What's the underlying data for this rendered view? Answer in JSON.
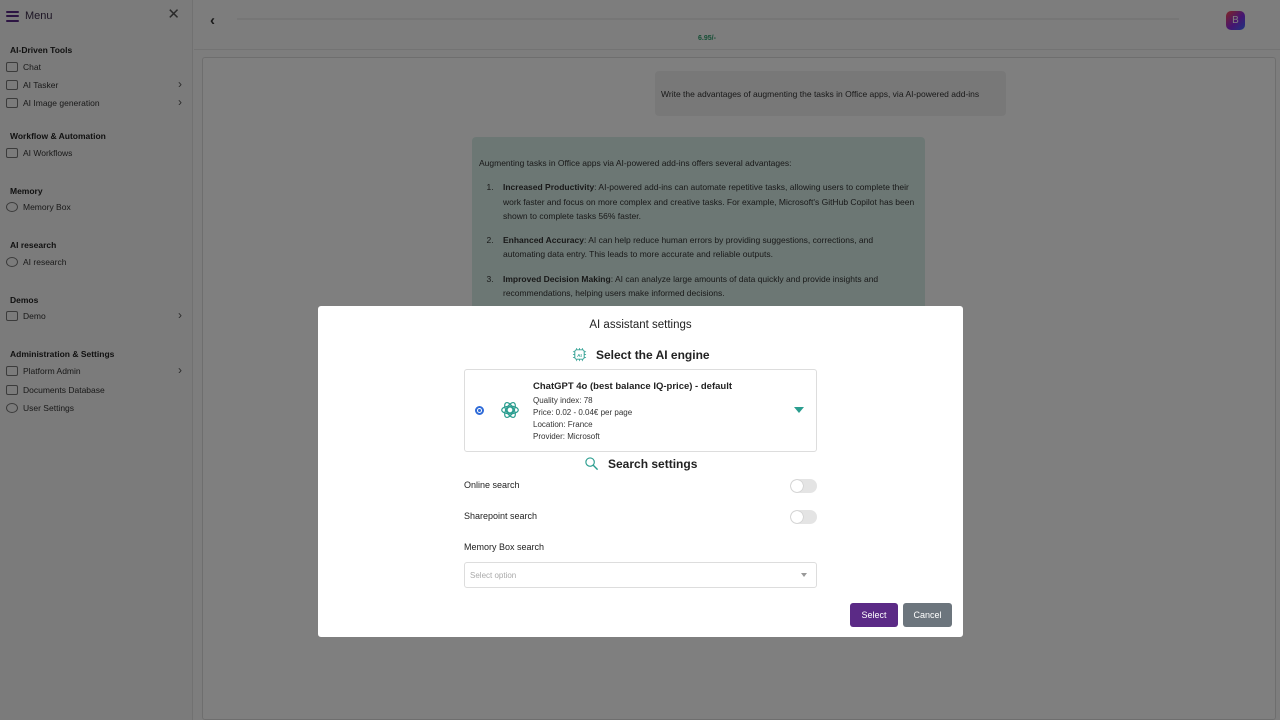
{
  "sidebar": {
    "menu_label": "Menu",
    "sections": [
      {
        "title": "AI-Driven Tools",
        "items": [
          {
            "label": "Chat",
            "icon": "chat-icon"
          },
          {
            "label": "AI Tasker",
            "icon": "tasker-icon"
          },
          {
            "label": "AI Image generation",
            "icon": "image-icon"
          }
        ]
      },
      {
        "title": "Workflow & Automation",
        "items": [
          {
            "label": "AI Workflows",
            "icon": "workflow-icon"
          }
        ]
      },
      {
        "title": "Memory",
        "items": [
          {
            "label": "Memory Box",
            "icon": "memory-icon"
          }
        ]
      },
      {
        "title": "AI research",
        "items": [
          {
            "label": "AI research",
            "icon": "research-icon"
          }
        ]
      },
      {
        "title": "Demos",
        "items": [
          {
            "label": "Demo",
            "icon": "demo-icon"
          }
        ]
      },
      {
        "title": "Administration & Settings",
        "items": [
          {
            "label": "Platform Admin",
            "icon": "admin-icon"
          },
          {
            "label": "Documents Database",
            "icon": "documents-icon"
          },
          {
            "label": "User Settings",
            "icon": "user-icon"
          }
        ]
      }
    ]
  },
  "topbar": {
    "price": "6.95/-",
    "avatar_letter": "B"
  },
  "chat": {
    "user_message": "Write the advantages of augmenting the tasks in Office apps, via AI-powered add-ins",
    "ai_intro": "Augmenting tasks in Office apps via AI-powered add-ins offers several advantages:",
    "ai_points": [
      {
        "title": "Increased Productivity",
        "text": ": AI-powered add-ins can automate repetitive tasks, allowing users to complete their work faster and focus on more complex and creative tasks. For example, Microsoft's GitHub Copilot has been shown to complete tasks 56% faster."
      },
      {
        "title": "Enhanced Accuracy",
        "text": ": AI can help reduce human errors by providing suggestions, corrections, and automating data entry. This leads to more accurate and reliable outputs."
      },
      {
        "title": "Improved Decision Making",
        "text": ": AI can analyze large amounts of data quickly and provide insights and recommendations, helping users make informed decisions."
      }
    ]
  },
  "modal": {
    "title": "AI assistant settings",
    "engine_heading": "Select the AI engine",
    "engine": {
      "name": "ChatGPT 4o (best balance IQ-price) - default",
      "quality": "Quality index: 78",
      "price": "Price: 0.02 - 0.04€ per page",
      "location": "Location: France",
      "provider": "Provider: Microsoft"
    },
    "search_heading": "Search settings",
    "online_search_label": "Online search",
    "sharepoint_search_label": "Sharepoint search",
    "memory_box_label": "Memory Box search",
    "select_placeholder": "Select option",
    "select_button": "Select",
    "cancel_button": "Cancel"
  },
  "colors": {
    "accent_purple": "#5b2a86",
    "teal": "#2a9d8f",
    "price_green": "#2a9d6a",
    "ai_bubble": "#d9efe9"
  }
}
